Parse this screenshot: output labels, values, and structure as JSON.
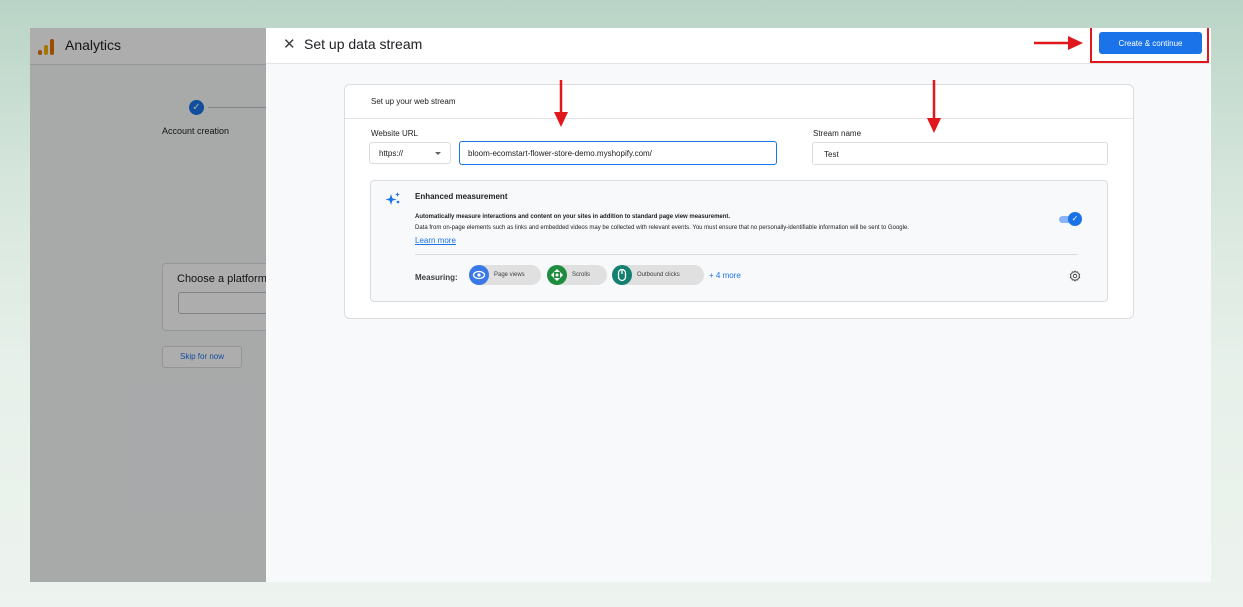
{
  "app": {
    "title": "Analytics",
    "stepper": {
      "step_label": "Account creation",
      "step_icon": "check-icon"
    },
    "platform": {
      "title": "Choose a platform"
    },
    "skip_label": "Skip for now"
  },
  "dialog": {
    "title": "Set up data stream",
    "close_icon": "close-icon",
    "create_label": "Create & continue",
    "card": {
      "title": "Set up your web stream",
      "website_url_label": "Website URL",
      "protocol": "https://",
      "url_value": "bloom-ecomstart-flower-store-demo.myshopify.com/",
      "stream_name_label": "Stream name",
      "stream_name_value": "Test"
    },
    "enhanced": {
      "title": "Enhanced measurement",
      "desc1": "Automatically measure interactions and content on your sites in addition to standard page view measurement.",
      "desc2": "Data from on-page elements such as links and embedded videos may be collected with relevant events. You must ensure that no personally-identifiable information will be sent to Google.",
      "learn_more": "Learn more",
      "toggle_on": true,
      "measuring_label": "Measuring:",
      "chips": [
        {
          "label": "Page views",
          "icon": "eye-icon",
          "color": "#3b78e7"
        },
        {
          "label": "Scrolls",
          "icon": "crosshair-icon",
          "color": "#1e8e3e"
        },
        {
          "label": "Outbound clicks",
          "icon": "mouse-icon",
          "color": "#12806f"
        }
      ],
      "more_label": "+ 4 more"
    }
  },
  "colors": {
    "accent": "#1a73e8",
    "annotation": "#e0171b"
  }
}
